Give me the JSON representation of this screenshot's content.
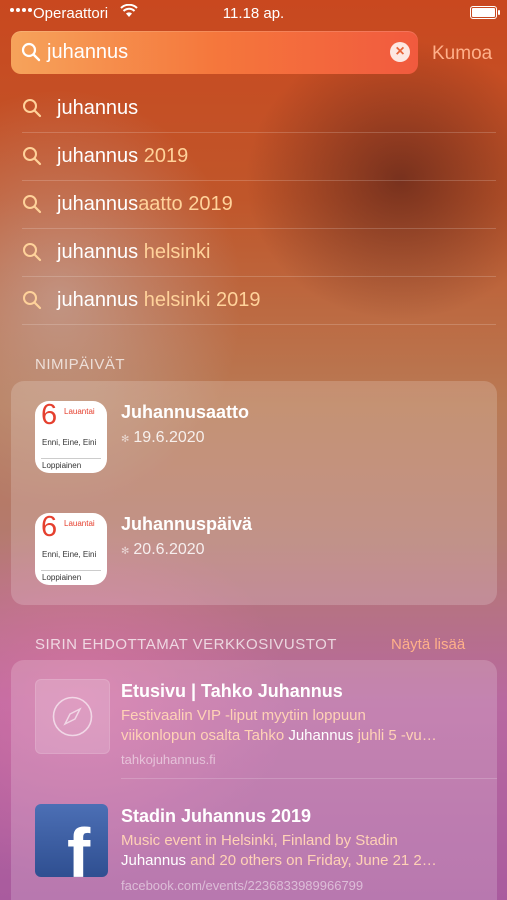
{
  "status_bar": {
    "carrier": "Operaattori",
    "time": "11.18 ap."
  },
  "search": {
    "value": "juhannus",
    "cancel_label": "Kumoa"
  },
  "suggestions": [
    {
      "typed": "juhannus",
      "rest": ""
    },
    {
      "typed": "juhannus",
      "rest": " 2019"
    },
    {
      "typed": "juhannus",
      "rest": "aatto 2019"
    },
    {
      "typed": "juhannus",
      "rest": " helsinki"
    },
    {
      "typed": "juhannus",
      "rest": " helsinki 2019"
    }
  ],
  "namedays": {
    "header": "NIMIPÄIVÄT",
    "items": [
      {
        "icon_day": "6",
        "icon_weekday": "Lauantai",
        "icon_names": "Enni, Eine, Eini",
        "icon_extra": "Loppiainen",
        "title": "Juhannusaatto",
        "date": "19.6.2020"
      },
      {
        "icon_day": "6",
        "icon_weekday": "Lauantai",
        "icon_names": "Enni, Eine, Eini",
        "icon_extra": "Loppiainen",
        "title": "Juhannuspäivä",
        "date": "20.6.2020"
      }
    ]
  },
  "siri_sites": {
    "header": "SIRIN EHDOTTAMAT VERKKOSIVUSTOT",
    "show_more": "Näytä lisää",
    "items": [
      {
        "icon": "safari-compass-icon",
        "title": "Etusivu | Tahko Juhannus",
        "desc_1": "Festivaalin VIP -liput myytiin loppuun",
        "desc_2a": "viikonlopun osalta Tahko ",
        "desc_2b": "Juhannus",
        "desc_2c": " juhli 5 -vu…",
        "url": "tahkojuhannus.fi"
      },
      {
        "icon": "facebook-icon",
        "title": "Stadin Juhannus 2019",
        "desc_1": "Music event in Helsinki, Finland by Stadin",
        "desc_2a": "",
        "desc_2b": "Juhannus",
        "desc_2c": " and 20 others on Friday, June 21 2…",
        "url": "facebook.com/events/2236833989966799"
      }
    ]
  },
  "colors": {
    "accent": "#ffb08a",
    "suggestion_completion": "#ffd29a"
  }
}
